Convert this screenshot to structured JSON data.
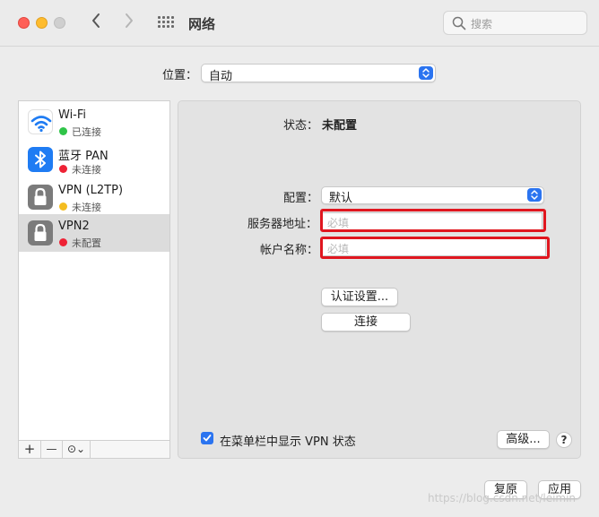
{
  "window": {
    "title": "网络",
    "search_placeholder": "搜索"
  },
  "location": {
    "label": "位置：",
    "value": "自动"
  },
  "services": [
    {
      "name": "Wi-Fi",
      "status": "已连接",
      "status_color": "#2fc448",
      "icon": "wifi-icon"
    },
    {
      "name": "蓝牙 PAN",
      "status": "未连接",
      "status_color": "#ee2235",
      "icon": "bluetooth-icon"
    },
    {
      "name": "VPN (L2TP)",
      "status": "未连接",
      "status_color": "#f4bd20",
      "icon": "lock-icon"
    },
    {
      "name": "VPN2",
      "status": "未配置",
      "status_color": "#ee2235",
      "icon": "lock-icon",
      "selected": true
    }
  ],
  "sidebar_toolbar": {
    "add": "+",
    "remove": "—",
    "actions": "⊙⌄"
  },
  "detail": {
    "status_label": "状态：",
    "status_value": "未配置",
    "config_label": "配置：",
    "config_value": "默认",
    "server_label": "服务器地址：",
    "server_placeholder": "必填",
    "account_label": "帐户名称：",
    "account_placeholder": "必填",
    "auth_button": "认证设置...",
    "connect_button": "连接",
    "show_vpn_status_label": "在菜单栏中显示 VPN 状态",
    "show_vpn_status_checked": true,
    "advanced_button": "高级...",
    "help_button": "?"
  },
  "footer": {
    "revert_button": "复原",
    "apply_button": "应用"
  },
  "watermark": "https://blog.csdn.net/leimin",
  "colors": {
    "accent": "#2b74f0",
    "highlight_box": "#e0161f"
  }
}
